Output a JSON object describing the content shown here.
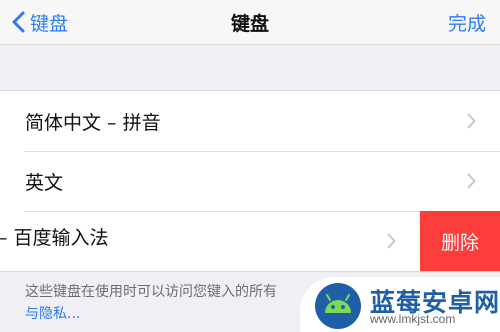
{
  "nav": {
    "back_label": "键盘",
    "title": "键盘",
    "done_label": "完成"
  },
  "keyboards": [
    {
      "label": "简体中文 – 拼音"
    },
    {
      "label": "英文"
    },
    {
      "label": "– 百度输入法"
    }
  ],
  "delete_label": "删除",
  "footer": {
    "text": "这些键盘在使用时可以访问您键入的所有",
    "link": "与隐私..."
  },
  "watermark": {
    "name": "蓝莓安卓网",
    "url": "www.lmkjst.com"
  },
  "colors": {
    "accent": "#2b7cf6",
    "delete": "#fc3d39",
    "background": "#efeff4"
  }
}
